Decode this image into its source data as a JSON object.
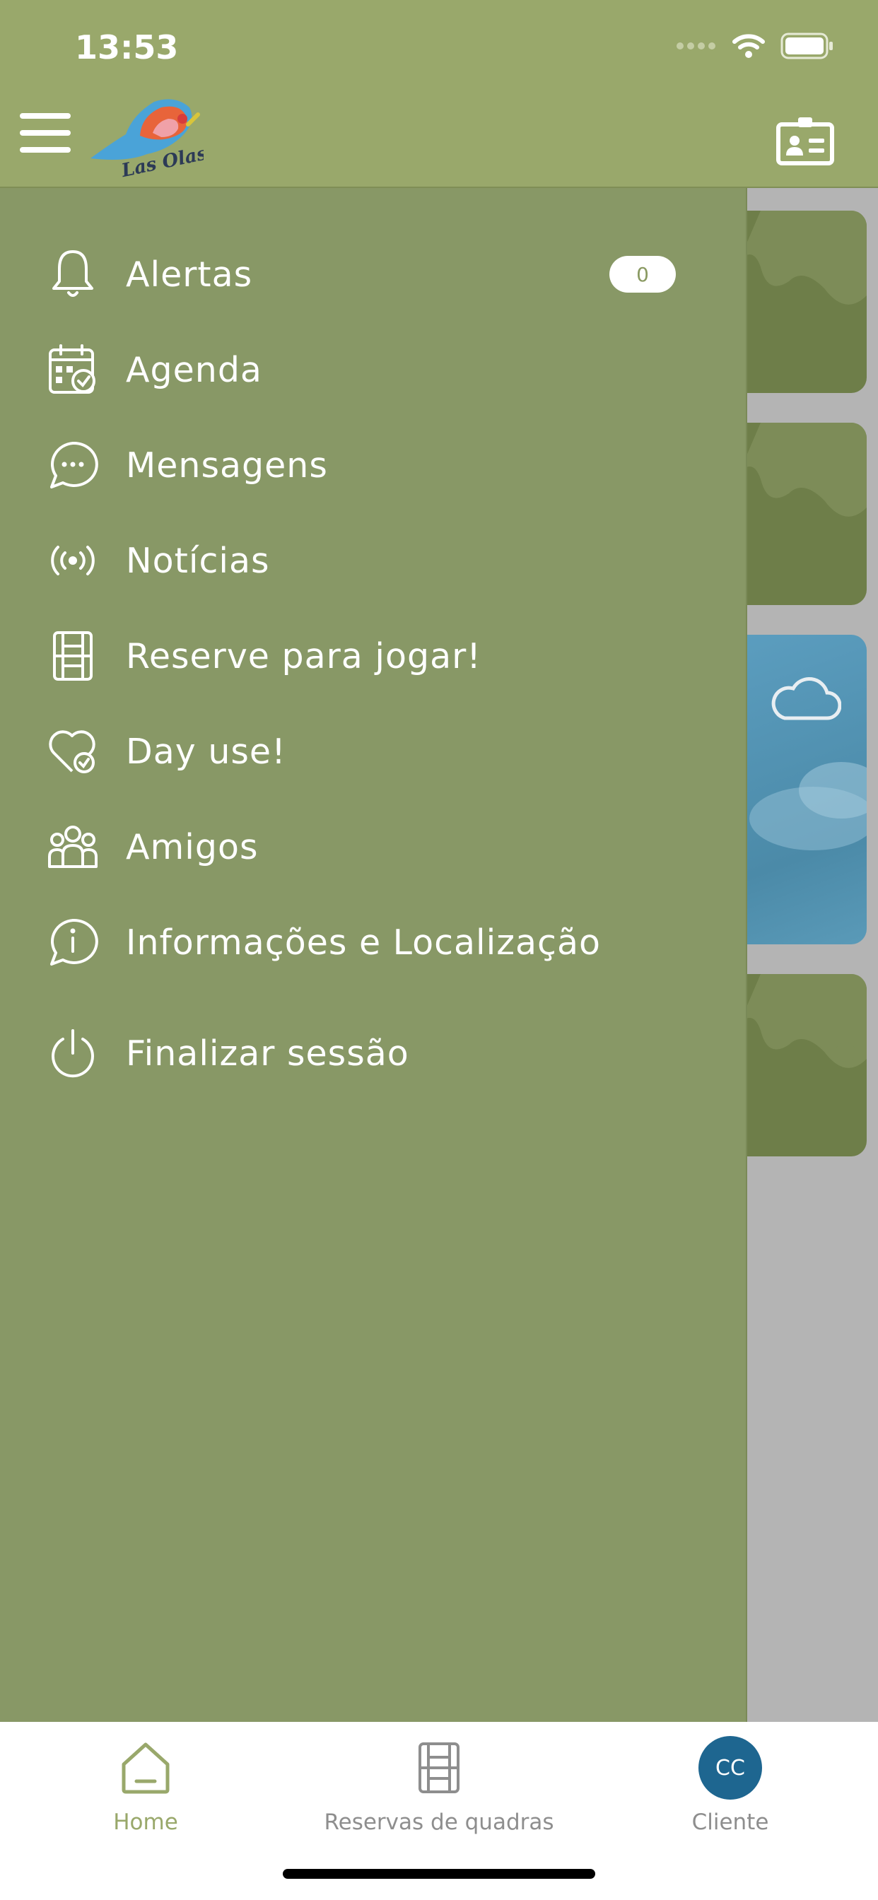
{
  "status_bar": {
    "time": "13:53"
  },
  "header": {
    "logo_text": "Las Olas"
  },
  "drawer": {
    "items": [
      {
        "label": "Alertas",
        "icon": "bell-icon",
        "badge": "0"
      },
      {
        "label": "Agenda",
        "icon": "calendar-check-icon"
      },
      {
        "label": "Mensagens",
        "icon": "chat-bubble-icon"
      },
      {
        "label": "Notícias",
        "icon": "broadcast-icon"
      },
      {
        "label": "Reserve para jogar!",
        "icon": "court-icon"
      },
      {
        "label": "Day use!",
        "icon": "heart-check-icon"
      },
      {
        "label": "Amigos",
        "icon": "people-icon"
      },
      {
        "label": "Informações e Localização",
        "icon": "info-bubble-icon"
      },
      {
        "label": "Finalizar sessão",
        "icon": "power-icon"
      }
    ]
  },
  "tabbar": {
    "home": {
      "label": "Home",
      "icon": "home-icon"
    },
    "reservas": {
      "label": "Reservas de quadras",
      "icon": "court-icon"
    },
    "cliente": {
      "label": "Cliente",
      "avatar": "CC"
    }
  },
  "colors": {
    "header": "#99a86b",
    "drawer": "#889866",
    "accent": "#99a86b",
    "avatar": "#1e6690"
  }
}
